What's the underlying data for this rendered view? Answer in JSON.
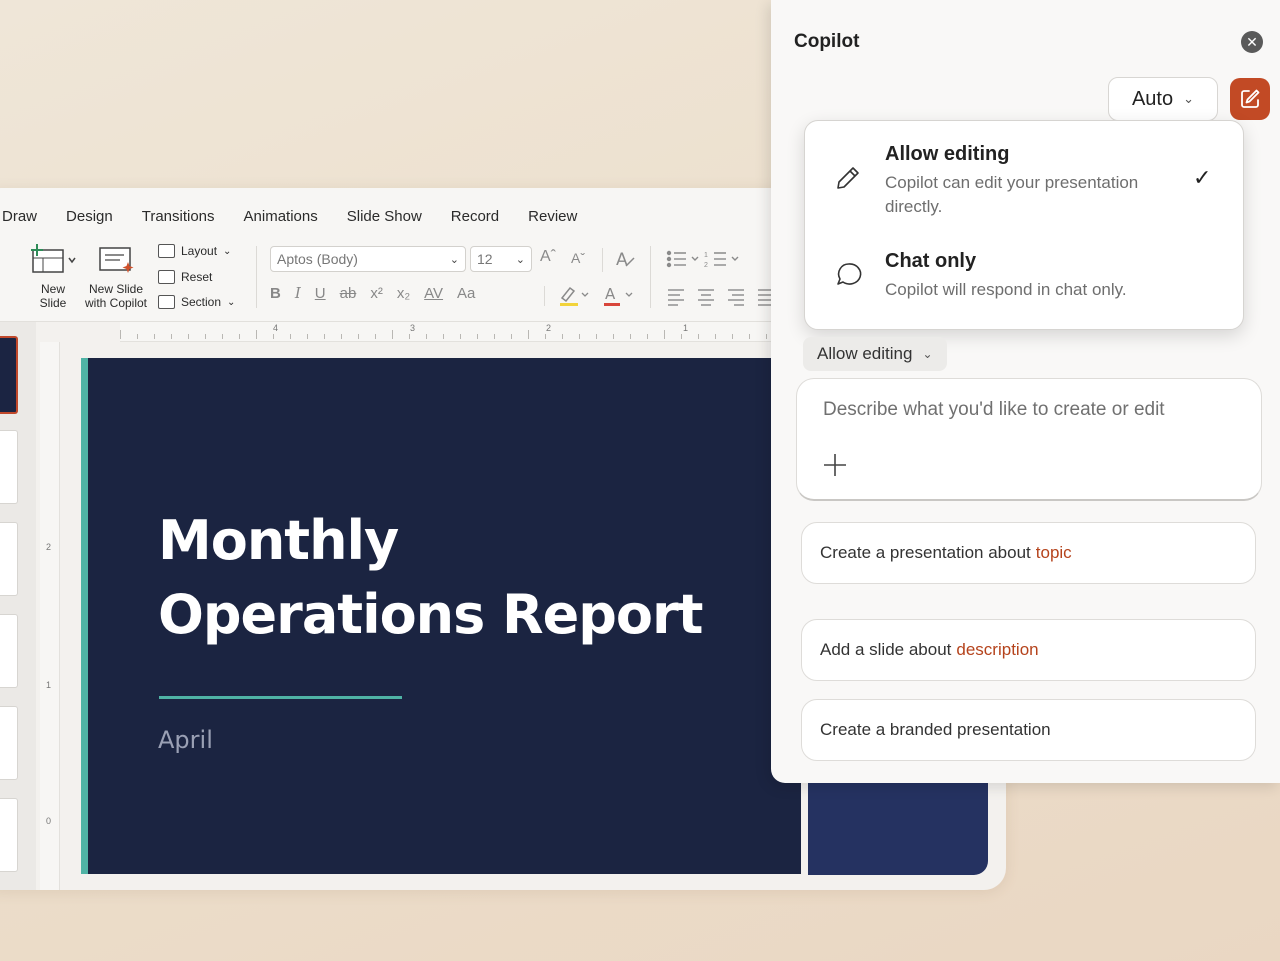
{
  "ppt": {
    "menu_tabs": [
      "Draw",
      "Design",
      "Transitions",
      "Animations",
      "Slide Show",
      "Record",
      "Review"
    ],
    "ribbon": {
      "new_slide": "New\nSlide",
      "new_slide_line1": "New",
      "new_slide_line2": "Slide",
      "new_slide_copilot_line1": "New Slide",
      "new_slide_copilot_line2": "with Copilot",
      "layout": "Layout",
      "reset": "Reset",
      "section": "Section",
      "font_name": "Aptos (Body)",
      "font_size": "12",
      "grow_font": "Aˆ",
      "shrink_font": "Aˇ",
      "bold": "B",
      "italic": "I",
      "underline": "U",
      "strikethrough": "ab",
      "superscript": "x²",
      "subscript": "x₂",
      "char_spacing": "AV",
      "change_case": "Aa"
    },
    "ruler_numbers": [
      "4",
      "3",
      "2",
      "1"
    ],
    "vruler_numbers": [
      "2",
      "1",
      "0"
    ]
  },
  "slide": {
    "title_line1": "Monthly",
    "title_line2": "Operations Report",
    "subtitle": "April",
    "accent_color": "#4fb3a5",
    "background_color": "#1b2441"
  },
  "copilot": {
    "title": "Copilot",
    "close_icon": "close-icon",
    "model_select": "Auto",
    "new_chat_icon": "compose-icon",
    "brand_color": "#c24a25",
    "mode_options": [
      {
        "name": "Allow editing",
        "description": "Copilot can edit your presentation directly.",
        "selected": true,
        "icon": "pencil-icon"
      },
      {
        "name": "Chat only",
        "description": "Copilot will respond in chat only.",
        "selected": false,
        "icon": "chat-bubble-icon"
      }
    ],
    "mode_selected": "Allow editing",
    "prompt_placeholder": "Describe what you'd like to create or edit",
    "suggestions": [
      {
        "text": "Create a presentation about",
        "highlight": "topic"
      },
      {
        "text": "Add a slide about",
        "highlight": "description"
      },
      {
        "text": "Create a branded presentation",
        "highlight": ""
      }
    ]
  }
}
